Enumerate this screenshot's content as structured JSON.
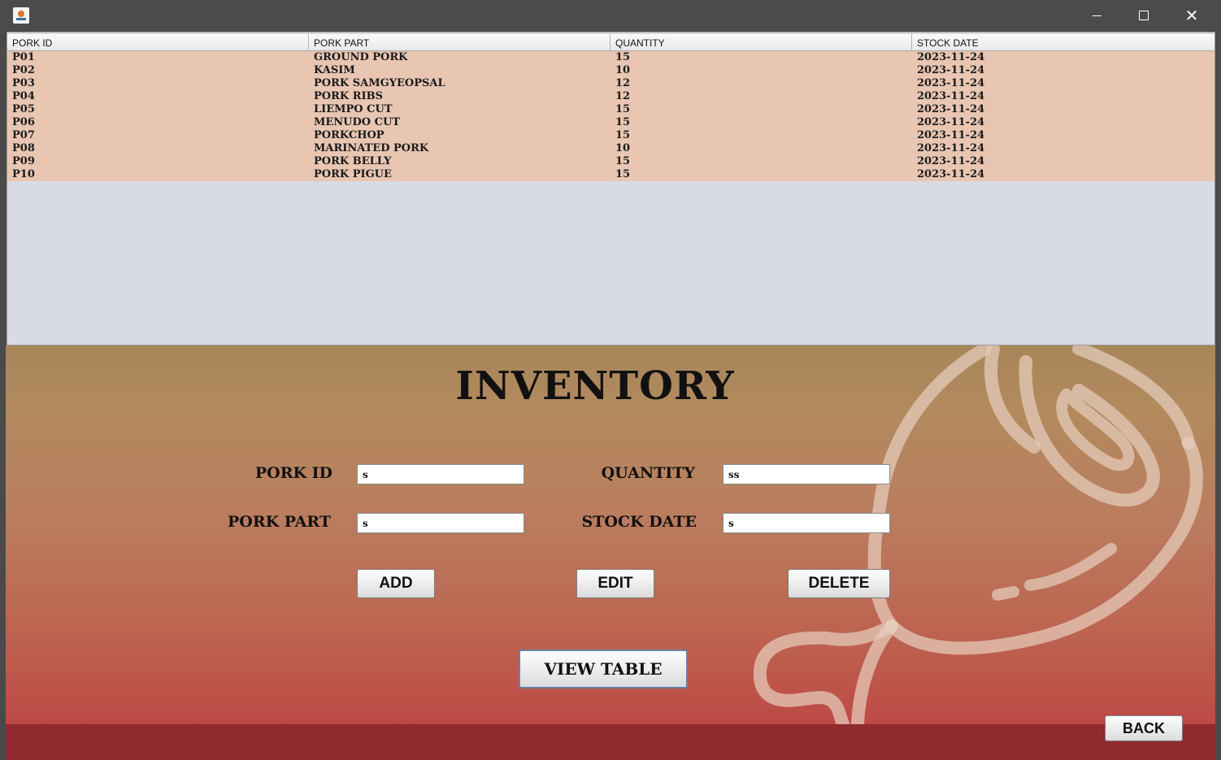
{
  "window": {
    "controls": {
      "minimize": "minimize-icon",
      "maximize": "maximize-icon",
      "close": "close-icon"
    }
  },
  "table": {
    "columns": [
      "PORK ID",
      "PORK PART",
      "QUANTITY",
      "STOCK DATE"
    ],
    "rows": [
      [
        "P01",
        "GROUND PORK",
        "15",
        "2023-11-24"
      ],
      [
        "P02",
        "KASIM",
        "10",
        "2023-11-24"
      ],
      [
        "P03",
        "PORK SAMGYEOPSAL",
        "12",
        "2023-11-24"
      ],
      [
        "P04",
        "PORK RIBS",
        "12",
        "2023-11-24"
      ],
      [
        "P05",
        "LIEMPO CUT",
        "15",
        "2023-11-24"
      ],
      [
        "P06",
        "MENUDO CUT",
        "15",
        "2023-11-24"
      ],
      [
        "P07",
        "PORKCHOP",
        "15",
        "2023-11-24"
      ],
      [
        "P08",
        "MARINATED PORK",
        "10",
        "2023-11-24"
      ],
      [
        "P09",
        "PORK BELLY",
        "15",
        "2023-11-24"
      ],
      [
        "P10",
        "PORK PIGUE",
        "15",
        "2023-11-24"
      ]
    ]
  },
  "form": {
    "title": "INVENTORY",
    "pork_id_label": "PORK ID",
    "pork_id_value": "s",
    "pork_part_label": "PORK PART",
    "pork_part_value": "s",
    "quantity_label": "QUANTITY",
    "quantity_value": "ss",
    "stock_date_label": "STOCK DATE",
    "stock_date_value": "s",
    "add_label": "ADD",
    "edit_label": "EDIT",
    "delete_label": "DELETE",
    "view_table_label": "VIEW TABLE",
    "back_label": "BACK"
  },
  "colors": {
    "table_rows_bg": "#e8c6b2",
    "table_empty_bg": "#d8dbe3",
    "footer_bg": "#8f2a2e",
    "decoration_stroke": "#e6cdbd"
  }
}
